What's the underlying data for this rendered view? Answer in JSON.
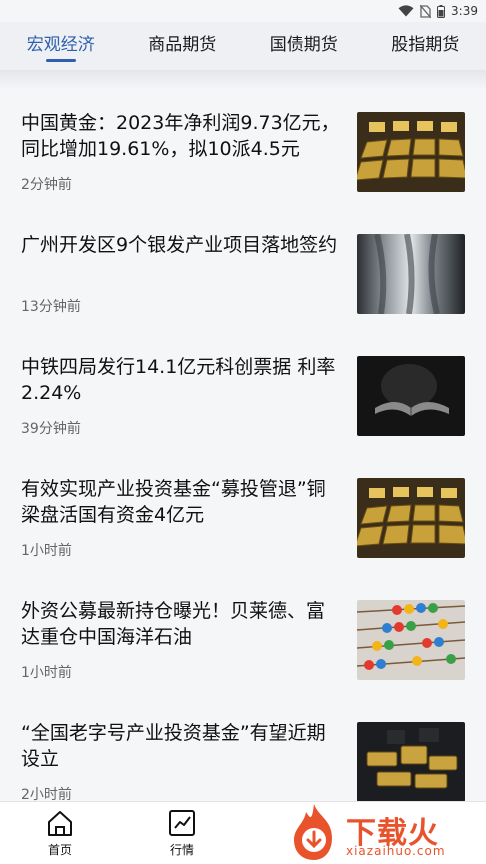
{
  "status_bar": {
    "time": "3:39"
  },
  "tabs": [
    {
      "label": "宏观经济",
      "active": true
    },
    {
      "label": "商品期货",
      "active": false
    },
    {
      "label": "国债期货",
      "active": false
    },
    {
      "label": "股指期货",
      "active": false
    }
  ],
  "news": [
    {
      "title": "中国黄金：2023年净利润9.73亿元，同比增加19.61%，拟10派4.5元",
      "time": "2分钟前",
      "thumb": "gold-bars"
    },
    {
      "title": "广州开发区9个银发产业项目落地签约",
      "time": "13分钟前",
      "thumb": "silver-metal"
    },
    {
      "title": "中铁四局发行14.1亿元科创票据 利率2.24%",
      "time": "39分钟前",
      "thumb": "open-book"
    },
    {
      "title": "有效实现产业投资基金“募投管退”铜梁盘活国有资金4亿元",
      "time": "1小时前",
      "thumb": "gold-bars"
    },
    {
      "title": "外资公募最新持仓曝光！贝莱德、富达重仓中国海洋石油",
      "time": "1小时前",
      "thumb": "abacus"
    },
    {
      "title": "“全国老字号产业投资基金”有望近期设立",
      "time": "2小时前",
      "thumb": "gold-ingots"
    }
  ],
  "bottom_nav": [
    {
      "label": "首页",
      "icon": "home-icon"
    },
    {
      "label": "行情",
      "icon": "market-chart-icon"
    }
  ],
  "watermark": {
    "brand": "下载火",
    "url": "xiazaihuo.com"
  },
  "colors": {
    "accent": "#2f5fae",
    "background": "#f5f6f8",
    "watermark": "#e9532c"
  }
}
